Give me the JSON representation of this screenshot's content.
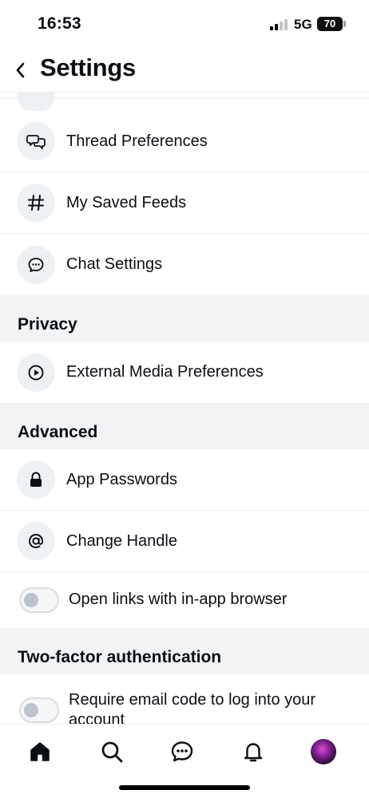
{
  "status_bar": {
    "time": "16:53",
    "network": "5G",
    "battery": "70"
  },
  "header": {
    "title": "Settings"
  },
  "rows": {
    "thread_prefs": "Thread Preferences",
    "saved_feeds": "My Saved Feeds",
    "chat_settings": "Chat Settings",
    "external_media": "External Media Preferences",
    "app_passwords": "App Passwords",
    "change_handle": "Change Handle"
  },
  "sections": {
    "privacy": "Privacy",
    "advanced": "Advanced",
    "two_factor": "Two-factor authentication"
  },
  "toggles": {
    "in_app_browser": {
      "label": "Open links with in-app browser",
      "on": false
    },
    "email_code": {
      "label": "Require email code to log into your account",
      "on": false
    }
  },
  "tab_bar": {
    "items": [
      "home-icon",
      "search-icon",
      "chat-icon",
      "bell-icon",
      "avatar"
    ]
  },
  "colors": {
    "section_bg": "#f1f3f5",
    "icon_bg": "#eef1f4",
    "divider": "#eceff2",
    "text": "#0b0f14"
  }
}
